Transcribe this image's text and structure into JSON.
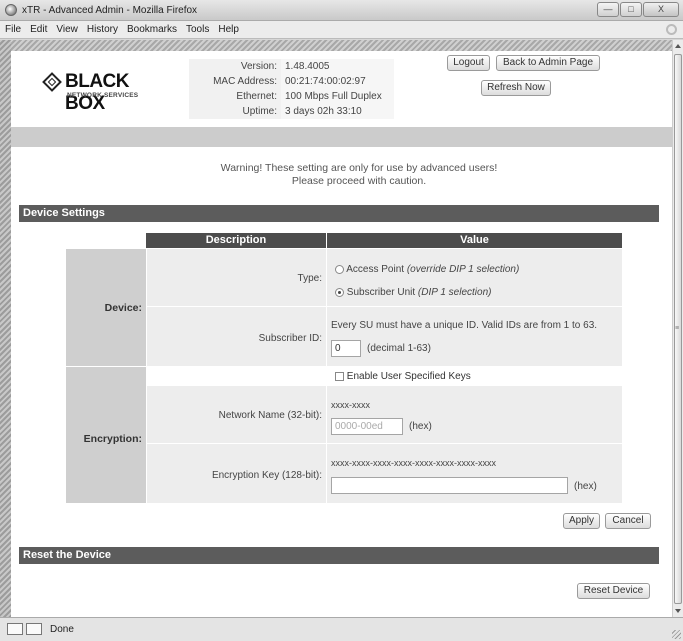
{
  "window": {
    "title": "xTR - Advanced Admin - Mozilla Firefox",
    "buttons": {
      "minimize": "—",
      "maximize": "□",
      "close": "X"
    }
  },
  "menu": [
    "File",
    "Edit",
    "View",
    "History",
    "Bookmarks",
    "Tools",
    "Help"
  ],
  "logo": {
    "brand": "BLACK BOX",
    "tagline": "NETWORK SERVICES"
  },
  "info": {
    "version_label": "Version:",
    "version": "1.48.4005",
    "mac_label": "MAC Address:",
    "mac": "00:21:74:00:02:97",
    "ethernet_label": "Ethernet:",
    "ethernet": "100 Mbps Full Duplex",
    "uptime_label": "Uptime:",
    "uptime": "3 days 02h 33:10"
  },
  "header_buttons": {
    "logout": "Logout",
    "back": "Back to Admin Page",
    "refresh": "Refresh Now"
  },
  "warning": {
    "line1": "Warning! These setting are only for use by advanced users!",
    "line2": "Please proceed with caution."
  },
  "device_settings": {
    "title": "Device Settings",
    "col_description": "Description",
    "col_value": "Value",
    "device_label": "Device:",
    "type_label": "Type:",
    "type_options": [
      {
        "label": "Access Point",
        "note": "(override DIP 1 selection)",
        "selected": false
      },
      {
        "label": "Subscriber Unit",
        "note": "(DIP 1 selection)",
        "selected": true
      }
    ],
    "subscriber_id_label": "Subscriber ID:",
    "subscriber_id_help": "Every SU must have a unique ID. Valid IDs are from 1 to 63.",
    "subscriber_id_value": "0",
    "subscriber_id_unit": "(decimal 1-63)",
    "encryption_label": "Encryption:",
    "enable_keys_label": "Enable User Specified Keys",
    "enable_keys_checked": false,
    "network_name_label": "Network Name (32-bit):",
    "network_name_format": "xxxx-xxxx",
    "network_name_placeholder": "0000-00ed",
    "network_name_unit": "(hex)",
    "encryption_key_label": "Encryption Key (128-bit):",
    "encryption_key_format": "xxxx-xxxx-xxxx-xxxx-xxxx-xxxx-xxxx-xxxx",
    "encryption_key_value": "",
    "encryption_key_unit": "(hex)",
    "apply": "Apply",
    "cancel": "Cancel"
  },
  "reset": {
    "title": "Reset the Device",
    "button": "Reset Device"
  },
  "status": {
    "text": "Done"
  }
}
